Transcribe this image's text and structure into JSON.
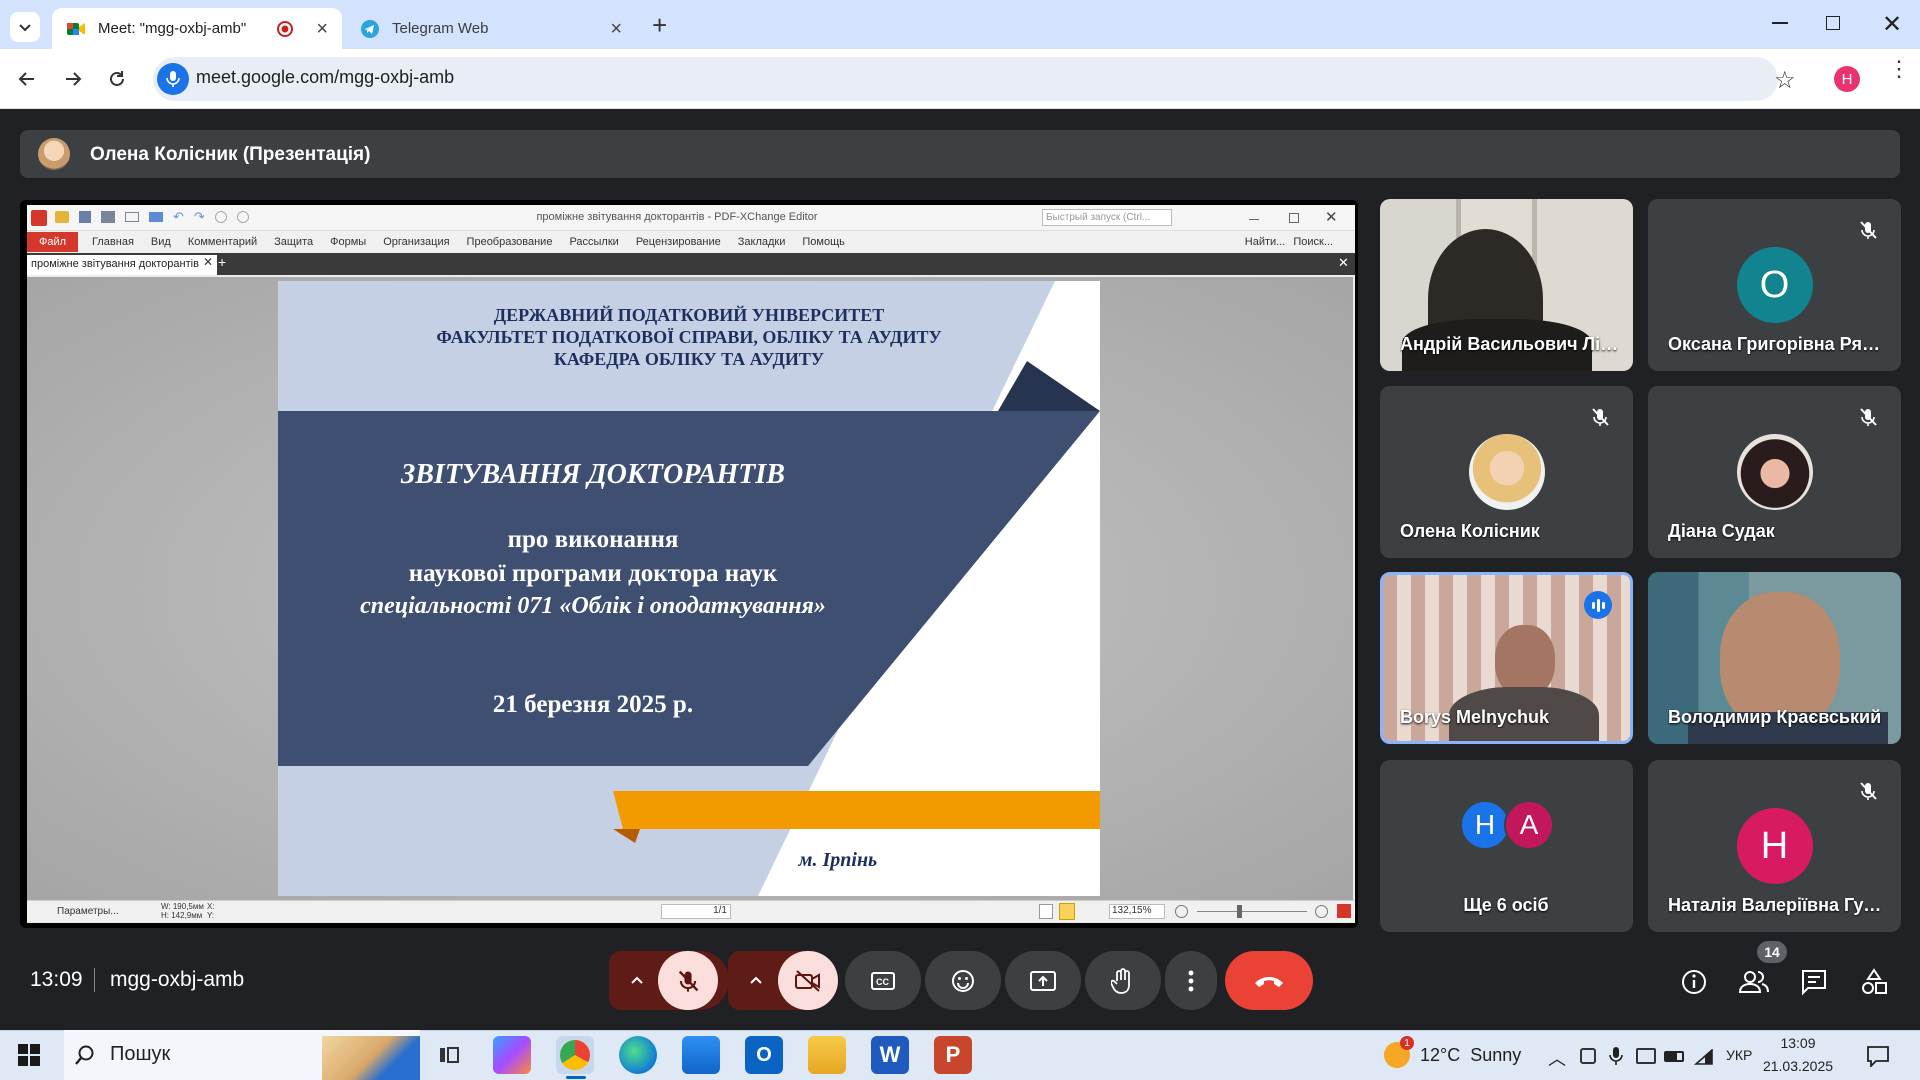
{
  "browser": {
    "tabs": [
      {
        "title": "Meet: \"mgg-oxbj-amb\"",
        "active": true
      },
      {
        "title": "Telegram Web",
        "active": false
      }
    ],
    "url": "meet.google.com/mgg-oxbj-amb",
    "profile_initial": "H",
    "colors": {
      "tabstrip": "#d3e3fd",
      "profile": "#e8336e"
    }
  },
  "meet": {
    "presenter_label": "Олена Колісник (Презентація)",
    "time": "13:09",
    "meeting_code": "mgg-oxbj-amb",
    "participant_count": "14",
    "colors": {
      "end_call": "#ea4335",
      "muted_control": "#f9dedc",
      "speaking_border": "#8ab4f8"
    }
  },
  "pdf": {
    "window_title": "проміжне звітування докторантів - PDF-XChange Editor",
    "quick_launch_placeholder": "Быстрый запуск (Ctrl...",
    "menu": [
      "Файл",
      "Главная",
      "Вид",
      "Комментарий",
      "Защита",
      "Формы",
      "Организация",
      "Преобразование",
      "Рассылки",
      "Рецензирование",
      "Закладки",
      "Помощь"
    ],
    "find_label": "Найти...",
    "search_label": "Поиск...",
    "doc_tab": "проміжне звітування докторантів",
    "status": {
      "params_label": "Параметры...",
      "width": "W: 190,5мм",
      "height": "H: 142,9мм",
      "xy": "X:\nY:",
      "page": "1/1",
      "zoom": "132,15%"
    }
  },
  "slide": {
    "header_lines": [
      "ДЕРЖАВНИЙ ПОДАТКОВИЙ УНІВЕРСИТЕТ",
      "ФАКУЛЬТЕТ ПОДАТКОВОЇ СПРАВИ, ОБЛІКУ ТА АУДИТУ",
      "КАФЕДРА ОБЛІКУ ТА АУДИТУ"
    ],
    "title": "ЗВІТУВАННЯ  ДОКТОРАНТІВ",
    "sub1": "про виконання",
    "sub2": "наукової програми доктора наук",
    "sub3": "спеціальності 071 «Облік і оподаткування»",
    "date": "21 березня 2025 р.",
    "city": "м. Ірпінь",
    "colors": {
      "navy": "#3e4f72",
      "light": "#c5d0e4",
      "dark": "#263450",
      "orange": "#f39a00",
      "text": "#1e2f5e"
    }
  },
  "participants": [
    {
      "name": "Андрій Васильович Ліс...",
      "type": "video",
      "muted": false
    },
    {
      "name": "Оксана Григорівна Ряб...",
      "type": "letter",
      "letter": "О",
      "color": "#12848f",
      "muted": true
    },
    {
      "name": "Олена Колісник",
      "type": "photo",
      "muted": true
    },
    {
      "name": "Діана Судак",
      "type": "photo",
      "muted": true
    },
    {
      "name": "Borys Melnychuk",
      "type": "video",
      "muted": false,
      "speaking": true
    },
    {
      "name": "Володимир Краєвський",
      "type": "video",
      "muted": false
    },
    {
      "name": "Ще 6 осіб",
      "type": "group",
      "letters": [
        "Н",
        "А"
      ],
      "colors": [
        "#1a73e8",
        "#c2185b"
      ]
    },
    {
      "name": "Наталія Валеріївна Гурі...",
      "type": "letter",
      "letter": "Н",
      "color": "#d81b60",
      "muted": true
    }
  ],
  "taskbar": {
    "search_placeholder": "Пошук",
    "weather": "12°C  Sunny",
    "weather_badge": "1",
    "language": "УКР",
    "time": "13:09",
    "date": "21.03.2025"
  }
}
